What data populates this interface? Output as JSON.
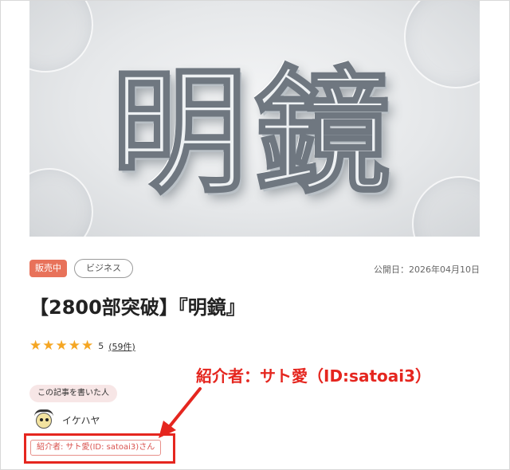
{
  "hero": {
    "title_art": "明鏡"
  },
  "article": {
    "status_badge": "販売中",
    "category": "ビジネス",
    "publish_date": "公開日：2026年04月10日",
    "title": "【2800部突破】『明鏡』"
  },
  "rating": {
    "stars": 5,
    "score": "5",
    "count": "(59件)",
    "star_glyph": "★",
    "star_color": "#f5a623"
  },
  "author": {
    "section_label": "この記事を書いた人",
    "name": "イケハヤ"
  },
  "referrer": {
    "tag": "紹介者: サト愛(ID: satoai3)さん"
  },
  "annotation": {
    "callout": "紹介者：サト愛（ID:satoai3）",
    "color": "#e5261f"
  },
  "colors": {
    "badge": "#e8725a",
    "author_label_bg": "#f7e6e6",
    "highlight": "#e5261f"
  }
}
